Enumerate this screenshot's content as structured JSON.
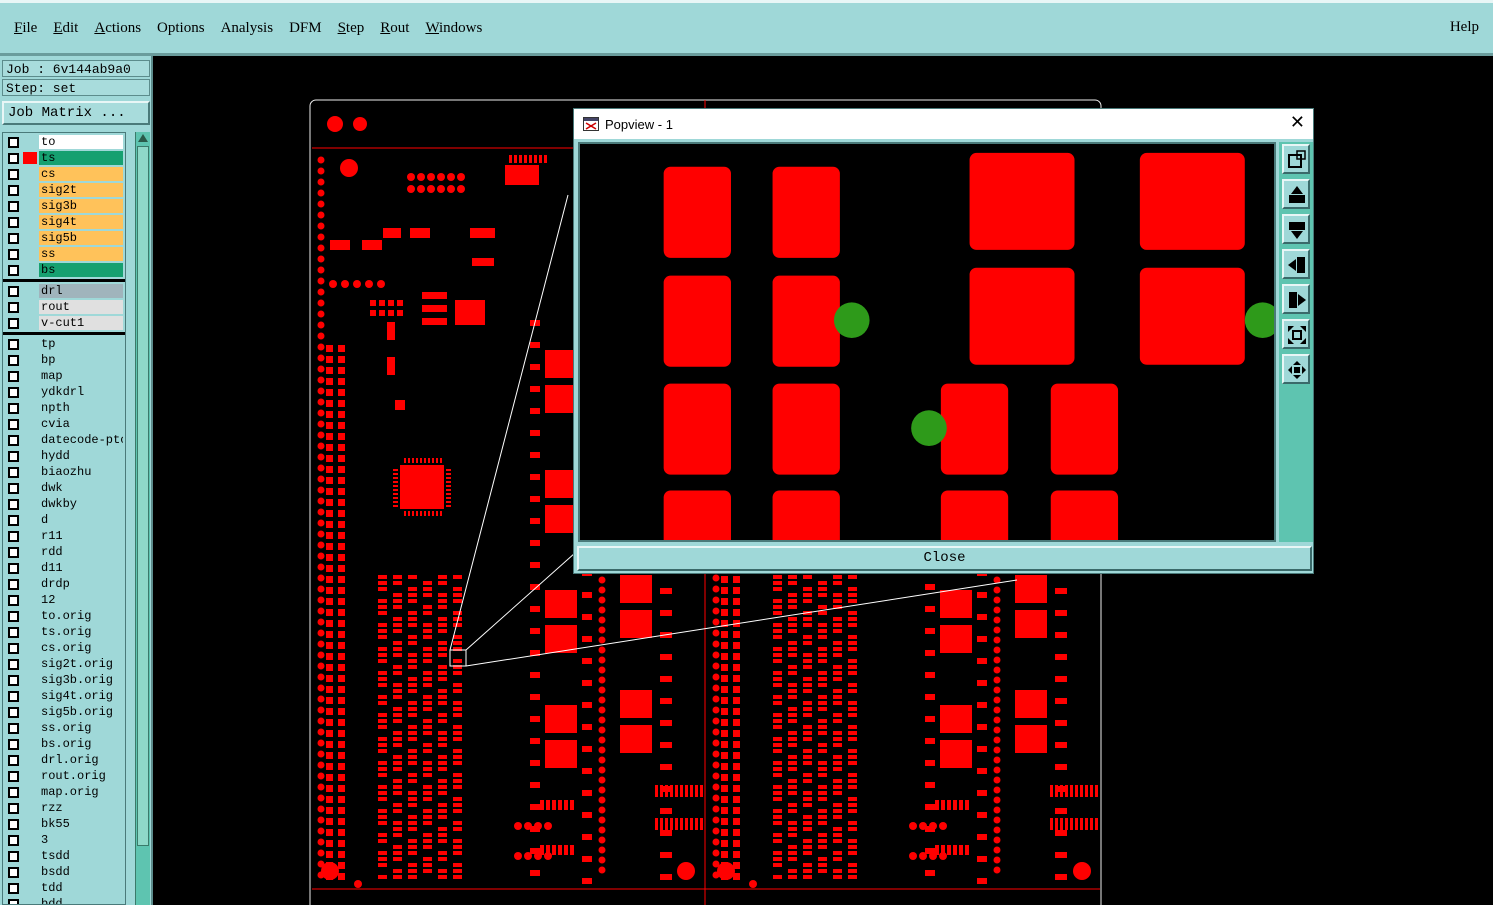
{
  "menubar": {
    "items": [
      {
        "label": "File",
        "underline": "F",
        "rest": "ile",
        "name": "menu-file"
      },
      {
        "label": "Edit",
        "underline": "E",
        "rest": "dit",
        "name": "menu-edit"
      },
      {
        "label": "Actions",
        "underline": "A",
        "rest": "ctions",
        "name": "menu-actions"
      },
      {
        "label": "Options",
        "underline": "",
        "rest": "Options",
        "name": "menu-options"
      },
      {
        "label": "Analysis",
        "underline": "",
        "rest": "Analysis",
        "name": "menu-analysis"
      },
      {
        "label": "DFM",
        "underline": "",
        "rest": "DFM",
        "name": "menu-dfm"
      },
      {
        "label": "Step",
        "underline": "S",
        "rest": "tep",
        "name": "menu-step"
      },
      {
        "label": "Rout",
        "underline": "R",
        "rest": "out",
        "name": "menu-rout"
      },
      {
        "label": "Windows",
        "underline": "W",
        "rest": "indows",
        "name": "menu-windows"
      }
    ],
    "help": "Help"
  },
  "sidebar": {
    "job": "Job : 6v144ab9a0",
    "step": "Step: set",
    "job_matrix": "Job Matrix ...",
    "groups": [
      [
        {
          "name": "to",
          "color": "#ffffff",
          "mark": ""
        },
        {
          "name": "ts",
          "color": "#16a070",
          "mark": "#ff0000"
        },
        {
          "name": "cs",
          "color": "#ffc25a",
          "mark": ""
        },
        {
          "name": "sig2t",
          "color": "#ffc25a",
          "mark": ""
        },
        {
          "name": "sig3b",
          "color": "#ffc25a",
          "mark": ""
        },
        {
          "name": "sig4t",
          "color": "#ffc25a",
          "mark": ""
        },
        {
          "name": "sig5b",
          "color": "#ffc25a",
          "mark": ""
        },
        {
          "name": "ss",
          "color": "#ffc25a",
          "mark": ""
        },
        {
          "name": "bs",
          "color": "#16a070",
          "mark": ""
        }
      ],
      [
        {
          "name": "drl",
          "color": "#a0b4bc",
          "mark": ""
        },
        {
          "name": "rout",
          "color": "#e0e0e0",
          "mark": ""
        },
        {
          "name": "v-cut1",
          "color": "#e0e0e0",
          "mark": ""
        }
      ],
      [
        {
          "name": "tp",
          "color": "#9fd8d8",
          "mark": ""
        },
        {
          "name": "bp",
          "color": "#9fd8d8",
          "mark": ""
        },
        {
          "name": "map",
          "color": "#9fd8d8",
          "mark": ""
        },
        {
          "name": "ydkdrl",
          "color": "#9fd8d8",
          "mark": ""
        },
        {
          "name": "npth",
          "color": "#9fd8d8",
          "mark": ""
        },
        {
          "name": "cvia",
          "color": "#9fd8d8",
          "mark": ""
        },
        {
          "name": "datecode-ptc",
          "color": "#9fd8d8",
          "mark": ""
        },
        {
          "name": "hydd",
          "color": "#9fd8d8",
          "mark": ""
        },
        {
          "name": "biaozhu",
          "color": "#9fd8d8",
          "mark": ""
        },
        {
          "name": "dwk",
          "color": "#9fd8d8",
          "mark": ""
        },
        {
          "name": "dwkby",
          "color": "#9fd8d8",
          "mark": ""
        },
        {
          "name": "d",
          "color": "#9fd8d8",
          "mark": ""
        },
        {
          "name": "r11",
          "color": "#9fd8d8",
          "mark": ""
        },
        {
          "name": "rdd",
          "color": "#9fd8d8",
          "mark": ""
        },
        {
          "name": "d11",
          "color": "#9fd8d8",
          "mark": ""
        },
        {
          "name": "drdp",
          "color": "#9fd8d8",
          "mark": ""
        },
        {
          "name": "12",
          "color": "#9fd8d8",
          "mark": ""
        },
        {
          "name": "to.orig",
          "color": "#9fd8d8",
          "mark": ""
        },
        {
          "name": "ts.orig",
          "color": "#9fd8d8",
          "mark": ""
        },
        {
          "name": "cs.orig",
          "color": "#9fd8d8",
          "mark": ""
        },
        {
          "name": "sig2t.orig",
          "color": "#9fd8d8",
          "mark": ""
        },
        {
          "name": "sig3b.orig",
          "color": "#9fd8d8",
          "mark": ""
        },
        {
          "name": "sig4t.orig",
          "color": "#9fd8d8",
          "mark": ""
        },
        {
          "name": "sig5b.orig",
          "color": "#9fd8d8",
          "mark": ""
        },
        {
          "name": "ss.orig",
          "color": "#9fd8d8",
          "mark": ""
        },
        {
          "name": "bs.orig",
          "color": "#9fd8d8",
          "mark": ""
        },
        {
          "name": "drl.orig",
          "color": "#9fd8d8",
          "mark": ""
        },
        {
          "name": "rout.orig",
          "color": "#9fd8d8",
          "mark": ""
        },
        {
          "name": "map.orig",
          "color": "#9fd8d8",
          "mark": ""
        },
        {
          "name": "rzz",
          "color": "#9fd8d8",
          "mark": ""
        },
        {
          "name": "bk55",
          "color": "#9fd8d8",
          "mark": ""
        },
        {
          "name": "3",
          "color": "#9fd8d8",
          "mark": ""
        },
        {
          "name": "tsdd",
          "color": "#9fd8d8",
          "mark": ""
        },
        {
          "name": "bsdd",
          "color": "#9fd8d8",
          "mark": ""
        },
        {
          "name": "tdd",
          "color": "#9fd8d8",
          "mark": ""
        },
        {
          "name": "bdd",
          "color": "#9fd8d8",
          "mark": ""
        }
      ]
    ]
  },
  "popview": {
    "title": "Popview - 1",
    "close_x": "✕",
    "close_button": "Close",
    "tools": [
      "zoom-window-icon",
      "pan-up-icon",
      "pan-down-icon",
      "pan-left-icon",
      "pan-right-icon",
      "zoom-home-icon",
      "zoom-fit-icon"
    ]
  },
  "colors": {
    "ui_bg": "#9fd8d8",
    "pad": "#ff0000",
    "via": "#2e9a1a",
    "canvas": "#000000"
  }
}
